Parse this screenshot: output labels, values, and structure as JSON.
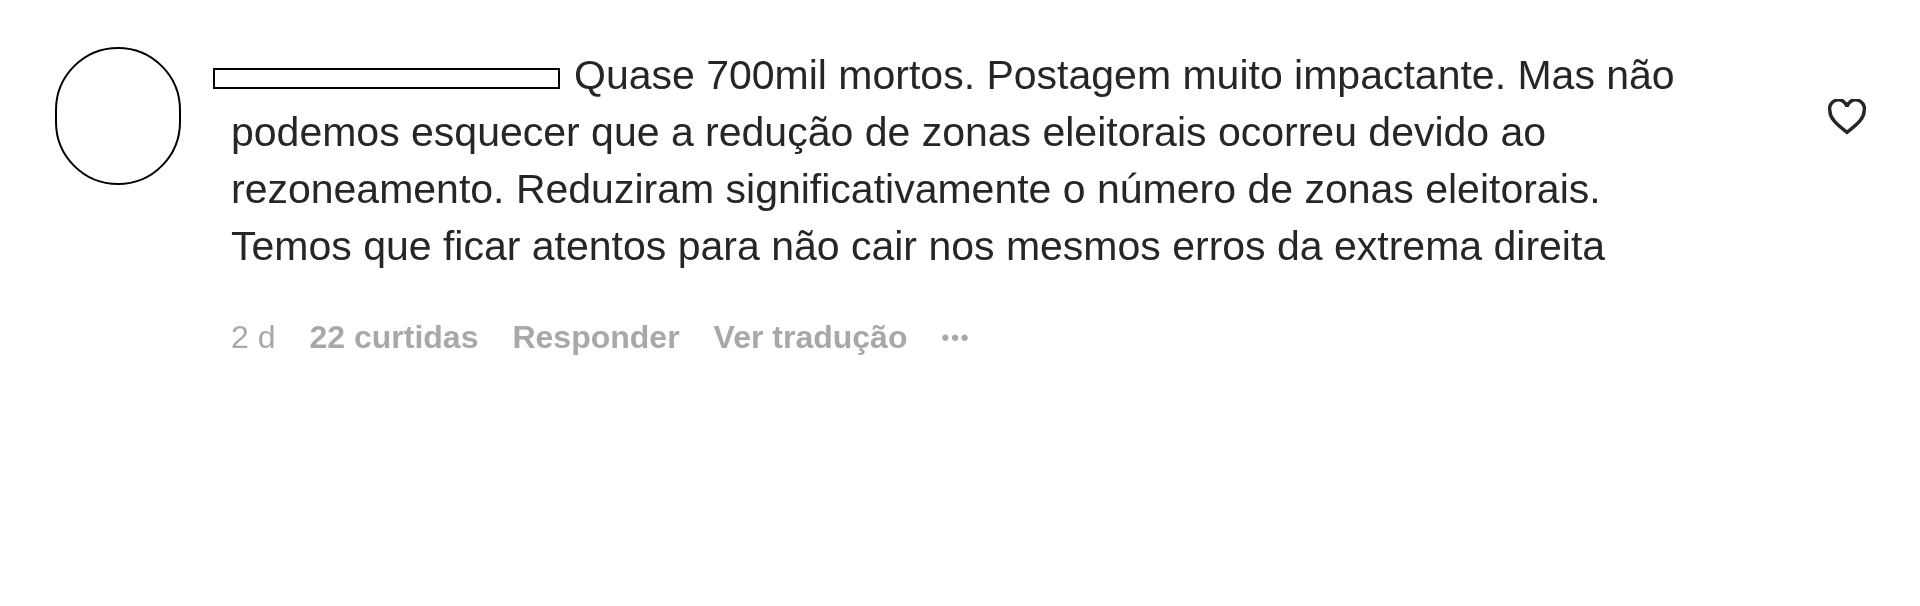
{
  "comment": {
    "text": "Quase 700mil mortos. Postagem muito impactante. Mas não podemos esquecer que a redução de zonas eleitorais ocorreu devido ao rezoneamento. Reduziram significativamente o número de zonas eleitorais. Temos que ficar atentos para não cair nos mesmos erros da extrema direita",
    "liked": false,
    "meta": [
      {
        "kind": "time",
        "label": "2 d"
      },
      {
        "kind": "likes",
        "label": "22 curtidas"
      },
      {
        "kind": "action",
        "label": "Responder"
      },
      {
        "kind": "action",
        "label": "Ver tradução"
      },
      {
        "kind": "more",
        "label": "•••"
      }
    ]
  }
}
